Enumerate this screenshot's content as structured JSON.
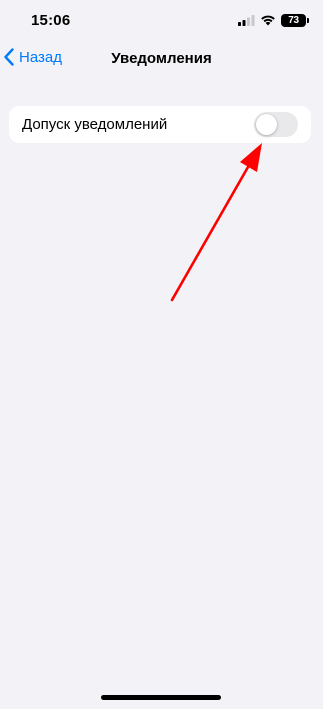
{
  "status_bar": {
    "time": "15:06",
    "battery_level": "73",
    "signal_icon": "cellular-signal-icon",
    "wifi_icon": "wifi-icon"
  },
  "nav": {
    "back_label": "Назад",
    "back_icon": "chevron-left-icon",
    "title": "Уведомления"
  },
  "settings": {
    "rows": [
      {
        "label": "Допуск уведомлений",
        "toggle_on": false
      }
    ]
  },
  "annotation": {
    "type": "arrow",
    "color": "#ff0000",
    "points_to": "notifications-toggle"
  },
  "colors": {
    "accent": "#007aff",
    "background": "#f2f2f7",
    "toggle_off": "#e9e9eb"
  }
}
